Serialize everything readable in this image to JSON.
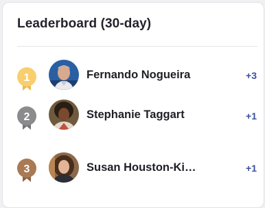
{
  "leaderboard": {
    "title": "Leaderboard (30-day)",
    "entries": [
      {
        "rank": "1",
        "name": "Fernando Nogueira",
        "delta": "+3",
        "medal_color": "#f7cf6e",
        "medal_shade": "#ebbb52",
        "medal_icon": "gold-medal-icon"
      },
      {
        "rank": "2",
        "name": "Stephanie Taggart",
        "delta": "+1",
        "medal_color": "#8b8b8d",
        "medal_shade": "#747476",
        "medal_icon": "silver-medal-icon"
      },
      {
        "rank": "3",
        "name": "Susan Houston-Kie…",
        "delta": "+1",
        "medal_color": "#a87a55",
        "medal_shade": "#8f6242",
        "medal_icon": "bronze-medal-icon"
      }
    ]
  }
}
